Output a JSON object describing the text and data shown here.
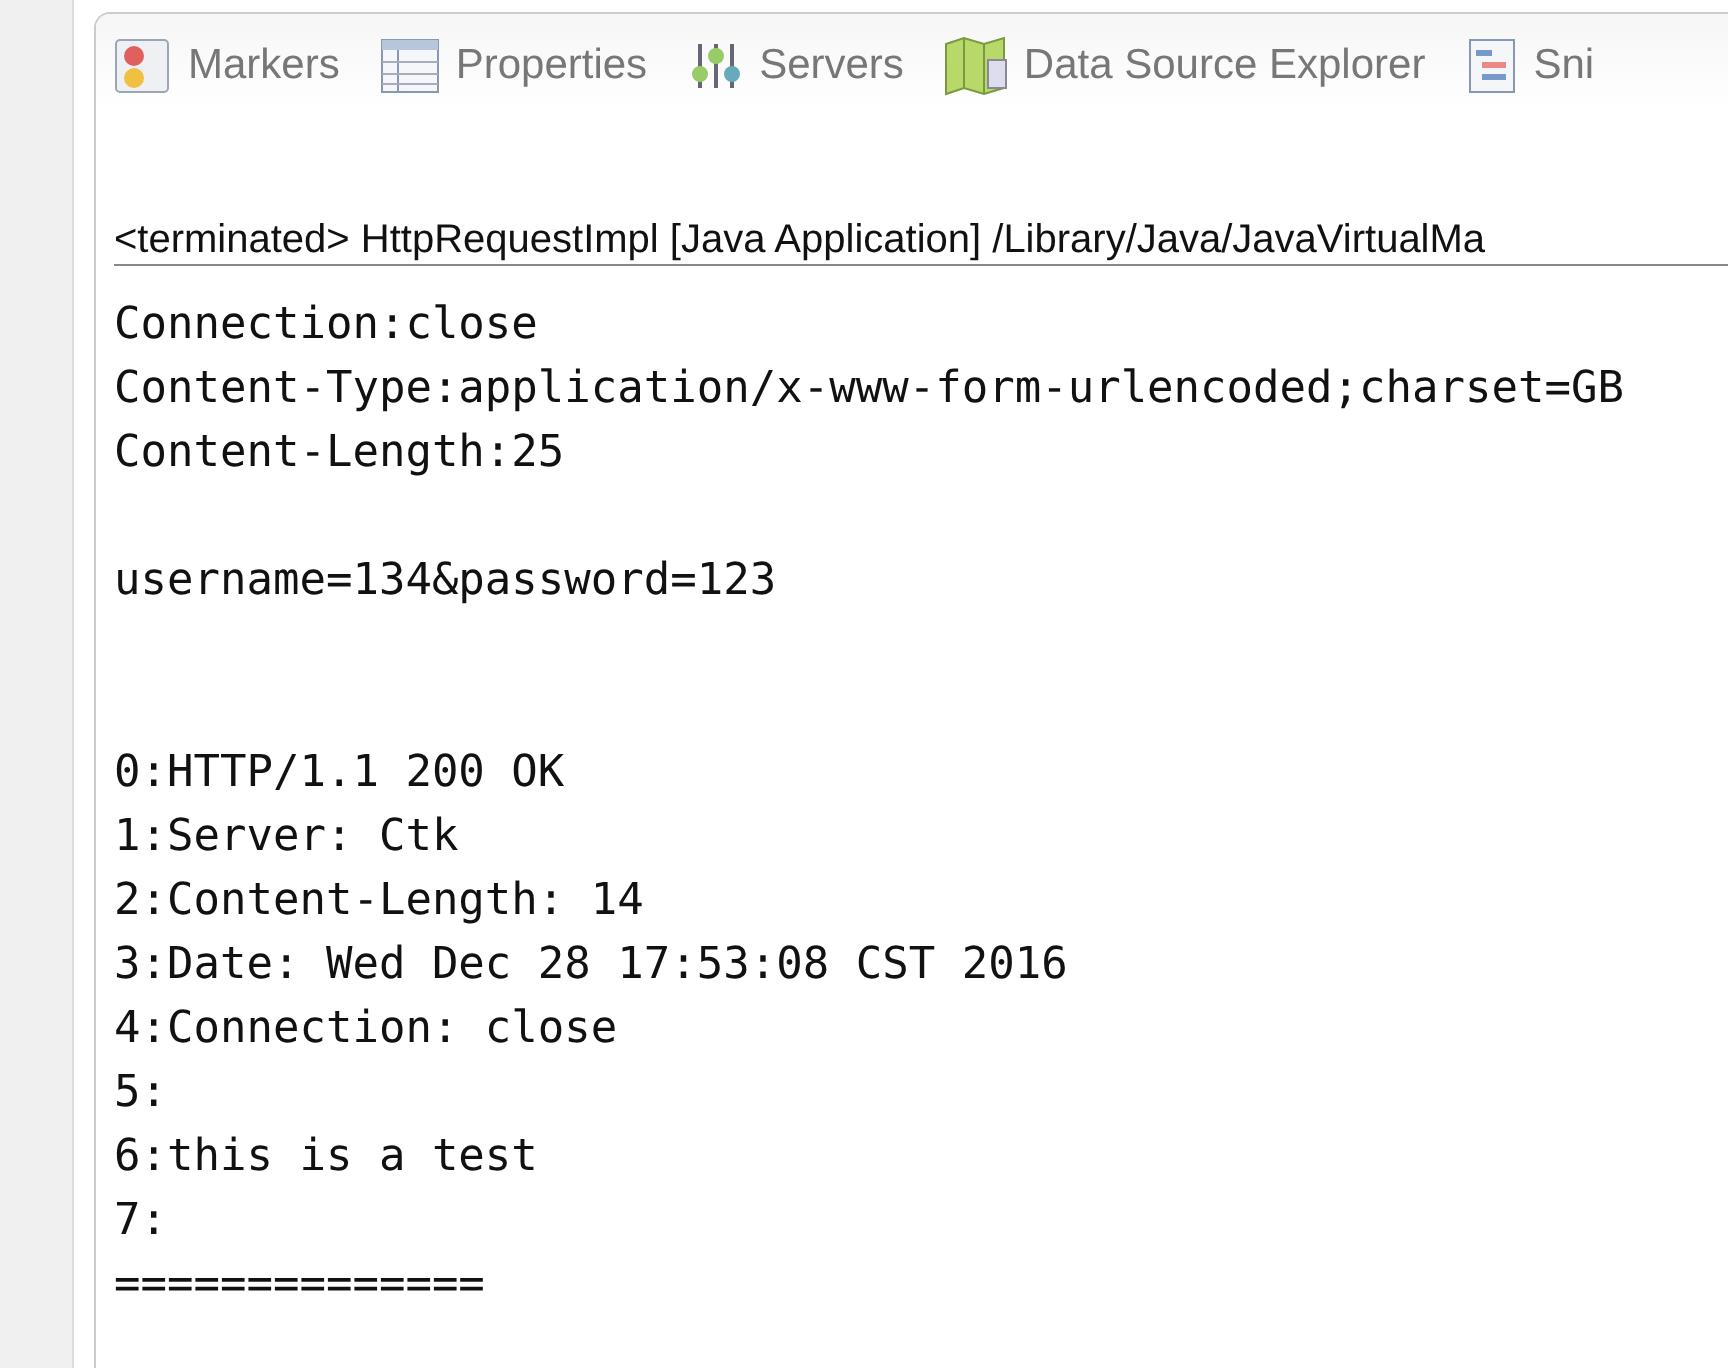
{
  "tabs": [
    {
      "label": "Markers"
    },
    {
      "label": "Properties"
    },
    {
      "label": "Servers"
    },
    {
      "label": "Data Source Explorer"
    },
    {
      "label": "Sni"
    }
  ],
  "console": {
    "header": "<terminated> HttpRequestImpl [Java Application] /Library/Java/JavaVirtualMa",
    "blocks": [
      {
        "lines": [
          "Connection:close",
          "Content-Type:application/x-www-form-urlencoded;charset=GB",
          "Content-Length:25"
        ]
      },
      {
        "lines": [
          "username=134&password=123"
        ]
      },
      {
        "lines": [
          "0:HTTP/1.1 200 OK",
          "1:Server: Ctk",
          "2:Content-Length: 14",
          "3:Date: Wed Dec 28 17:53:08 CST 2016",
          "4:Connection: close",
          "5:",
          "6:this is a test",
          "7:",
          "=============="
        ]
      }
    ]
  }
}
